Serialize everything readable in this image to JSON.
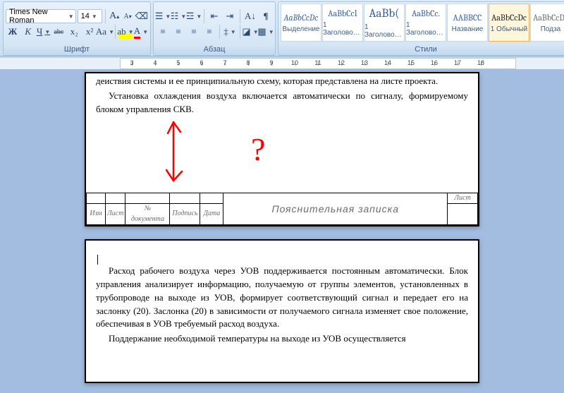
{
  "ribbon": {
    "font_group_label": "Шрифт",
    "para_group_label": "Абзац",
    "styles_group_label": "Стили",
    "font_name": "Times New Roman",
    "font_size": "14",
    "bold": "Ж",
    "italic": "К",
    "underline": "Ч",
    "strike": "abc",
    "sub": "x₂",
    "sup": "x²",
    "case": "Aa",
    "highlight": "ab",
    "fontcolor": "A",
    "grow": "A",
    "shrink": "A",
    "clear": "⌫",
    "bullets": "•",
    "numbers": "1",
    "multilevel": "≡",
    "dec_indent": "⇤",
    "inc_indent": "⇥",
    "sort": "A↓",
    "showmarks": "¶",
    "align_l": "≡",
    "align_c": "≡",
    "align_r": "≡",
    "align_j": "≡",
    "spacing": "‡",
    "shading": "▦",
    "borders": "▭"
  },
  "styles": [
    {
      "sample": "AaBbCcDc",
      "name": "Выделение",
      "color": "#3b67a7",
      "italic": true
    },
    {
      "sample": "AaBbCcI",
      "name": "1 Заголово…",
      "color": "#355e9f"
    },
    {
      "sample": "AaBb(",
      "name": "1 Заголово…",
      "color": "#355e9f",
      "big": true
    },
    {
      "sample": "AaBbCc.",
      "name": "1 Заголово…",
      "color": "#355e9f"
    },
    {
      "sample": "AABBCC",
      "name": "Название",
      "color": "#355e9f"
    },
    {
      "sample": "AaBbCcDc",
      "name": "1 Обычный",
      "color": "#222",
      "sel": true
    },
    {
      "sample": "AaBbCcDc",
      "name": "Подза",
      "color": "#6a6a6a"
    }
  ],
  "ruler": {
    "marks": [
      3,
      4,
      5,
      6,
      7,
      8,
      9,
      10,
      11,
      12,
      13,
      14,
      15,
      16,
      17,
      18
    ]
  },
  "doc": {
    "p1_l1": "деиствия системы и ее принципиальную схему, которая представлена на листе проекта.",
    "p1_l2": "Установка охлаждения воздуха включается автоматически по сигналу, формируемому блоком управления СКВ.",
    "frame": {
      "c1": "Изм",
      "c2": "Лист",
      "c3": "№ документа",
      "c4": "Подпись",
      "c5": "Дата",
      "title": "Пояснительная записка",
      "sheet": "Лист"
    },
    "p2_l1": "Расход рабочего воздуха через УОВ поддерживается постоянным автоматически. Блок управления анализирует информацию, получаемую от группы элементов, установленных в трубопроводе на выходе из УОВ, формирует соответствующий сигнал и передает его на заслонку (20). Заслонка (20) в зависимости от получаемого сигнала изменяет свое положение, обеспечивая в УОВ требуемый расход воздуха.",
    "p2_l2": "Поддержание необходимой температуры на выходе из УОВ осуществляется"
  },
  "annotation_q": "?"
}
